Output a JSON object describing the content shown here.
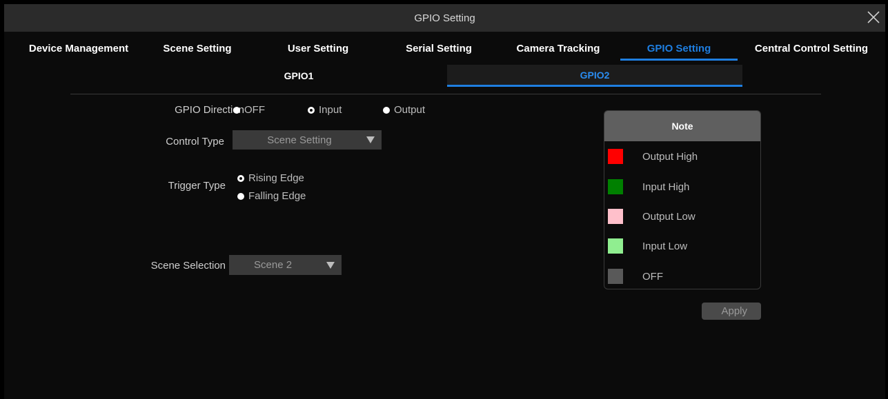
{
  "window": {
    "title": "GPIO Setting"
  },
  "tabs": [
    {
      "label": "Device Management",
      "active": false
    },
    {
      "label": "Scene Setting",
      "active": false
    },
    {
      "label": "User Setting",
      "active": false
    },
    {
      "label": "Serial Setting",
      "active": false
    },
    {
      "label": "Camera Tracking",
      "active": false
    },
    {
      "label": "GPIO Setting",
      "active": true
    },
    {
      "label": "Central Control Setting",
      "active": false
    }
  ],
  "subtabs": [
    {
      "label": "GPIO1",
      "active": false
    },
    {
      "label": "GPIO2",
      "active": true
    }
  ],
  "form": {
    "direction": {
      "label": "GPIO Direction",
      "options": [
        "OFF",
        "Input",
        "Output"
      ],
      "selected": "Input"
    },
    "control_type": {
      "label": "Control Type",
      "value": "Scene Setting"
    },
    "trigger_type": {
      "label": "Trigger Type",
      "options": [
        "Rising Edge",
        "Falling Edge"
      ],
      "selected": "Rising Edge"
    },
    "scene_selection": {
      "label": "Scene Selection",
      "value": "Scene 2"
    }
  },
  "note": {
    "title": "Note",
    "items": [
      {
        "label": "Output High",
        "color": "#ff0000"
      },
      {
        "label": "Input High",
        "color": "#008000"
      },
      {
        "label": "Output Low",
        "color": "#ffc0cb"
      },
      {
        "label": "Input Low",
        "color": "#90ee90"
      },
      {
        "label": "OFF",
        "color": "#595959"
      }
    ]
  },
  "apply_label": "Apply",
  "colors": {
    "accent": "#1e7ee0",
    "titlebar": "#2b2b2b",
    "background": "#0b0b0b"
  },
  "icons": {
    "close": "close-icon",
    "dropdown": "chevron-down-icon"
  }
}
